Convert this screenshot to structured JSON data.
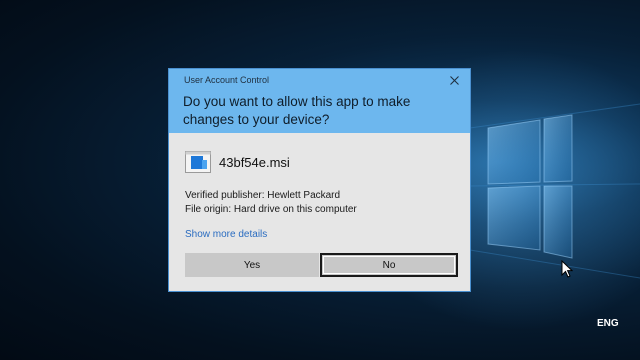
{
  "dialog": {
    "window_title": "User Account Control",
    "question": "Do you want to allow this app to make changes to your device?",
    "app_name": "43bf54e.msi",
    "publisher_line": "Verified publisher: Hewlett Packard",
    "origin_line": "File origin: Hard drive on this computer",
    "more_details_link": "Show more details",
    "yes_label": "Yes",
    "no_label": "No",
    "colors": {
      "header": "#6db7ee",
      "body": "#e6e6e6",
      "link": "#2a6cc0"
    }
  },
  "taskbar": {
    "language": "ENG"
  },
  "icons": [
    "close-icon",
    "msi-installer-icon",
    "mouse-cursor-icon",
    "windows-logo-graphic"
  ]
}
